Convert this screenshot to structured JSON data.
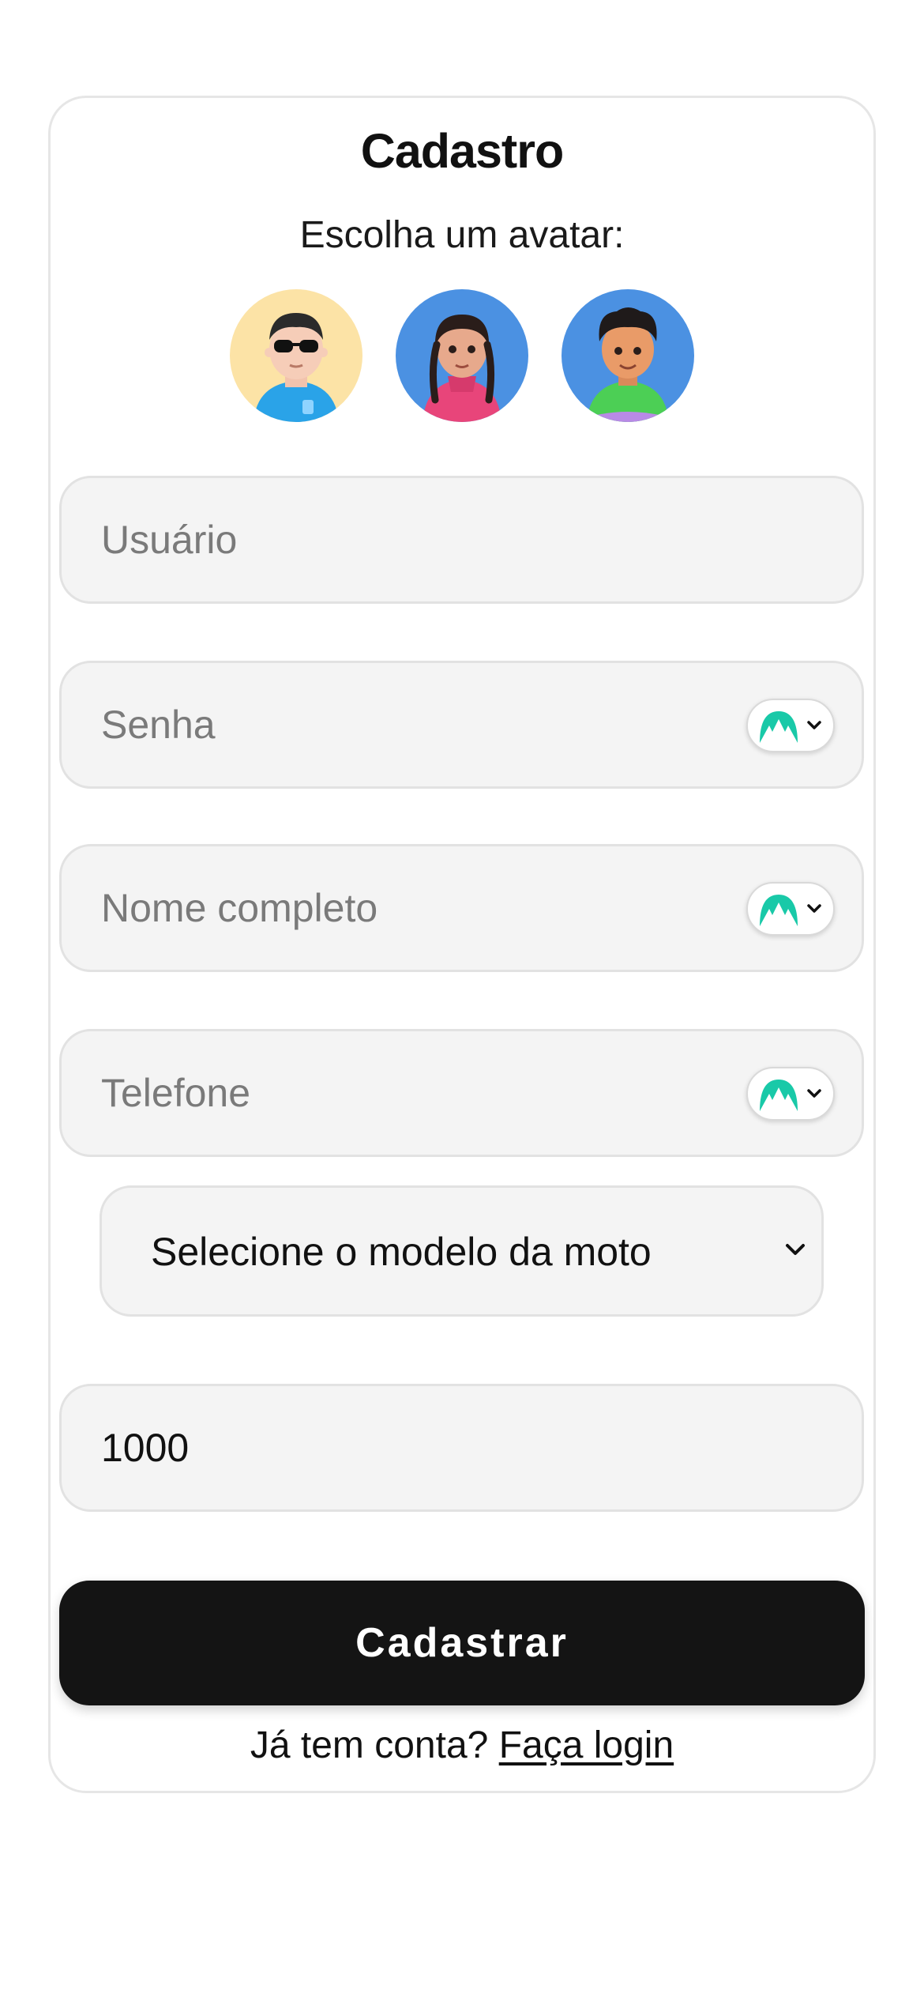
{
  "page": {
    "title": "Cadastro",
    "avatar_prompt": "Escolha um avatar:"
  },
  "avatars": [
    {
      "name": "avatar-man-sunglasses",
      "bg": "#fce3a6"
    },
    {
      "name": "avatar-woman-braids",
      "bg": "#4b91e2"
    },
    {
      "name": "avatar-man-curly-hair",
      "bg": "#4b91e2"
    }
  ],
  "fields": {
    "username": {
      "placeholder": "Usuário",
      "value": ""
    },
    "password": {
      "placeholder": "Senha",
      "value": ""
    },
    "full_name": {
      "placeholder": "Nome completo",
      "value": ""
    },
    "phone": {
      "placeholder": "Telefone",
      "value": ""
    },
    "moto_model": {
      "selected": "Selecione o modelo da moto"
    },
    "amount": {
      "placeholder": "",
      "value": "1000"
    }
  },
  "password_manager_icon": "nordpass-mountain-icon",
  "submit_label": "Cadastrar",
  "footer": {
    "question": "Já tem conta?",
    "login_link": "Faça login"
  },
  "colors": {
    "button_bg": "#141414",
    "field_bg": "#f4f4f4",
    "pw_manager_accent": "#19c9a8"
  }
}
